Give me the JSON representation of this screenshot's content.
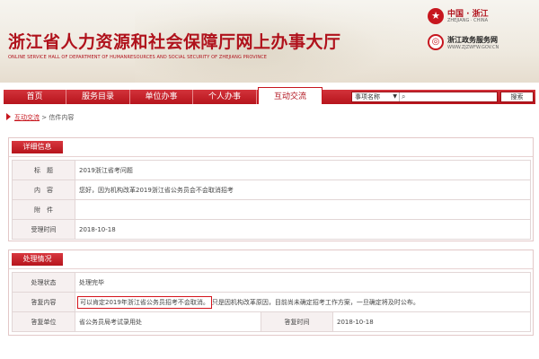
{
  "header": {
    "title": "浙江省人力资源和社会保障厅网上办事大厅",
    "subtitle": "ONLINE SERVICE HALL OF DEPARTMENT OF HUMANRESOURCES AND SOCIAL SECURITY OF ZHEJIANG PROVINCE",
    "brand_a": {
      "name": "中国 · 浙江",
      "sub": "ZHEJIANG · CHINA"
    },
    "brand_b": {
      "name": "浙江政务服务网",
      "sub": "WWW.ZJZWFW.GOV.CN"
    }
  },
  "nav": {
    "items": [
      {
        "label": "首页"
      },
      {
        "label": "服务目录"
      },
      {
        "label": "单位办事"
      },
      {
        "label": "个人办事"
      },
      {
        "label": "互动交流"
      }
    ],
    "active_index": 4,
    "search_select": "事项名称",
    "search_placeholder": "",
    "search_button": "搜索"
  },
  "breadcrumb": {
    "link": "互动交流",
    "separator": ">",
    "current": "信件内容"
  },
  "detail": {
    "heading": "详细信息",
    "rows": [
      {
        "label": "标　题",
        "value": "2019浙江省考问题"
      },
      {
        "label": "内　容",
        "value": "您好，因为机构改革2019浙江省公务员会不会取消招考"
      },
      {
        "label": "附　件",
        "value": ""
      },
      {
        "label": "受理时间",
        "value": "2018-10-18"
      }
    ]
  },
  "handling": {
    "heading": "处理情况",
    "status_label": "处理状态",
    "status_value": "处理完毕",
    "reply_label": "答复内容",
    "reply_highlight": "可以肯定2019年浙江省公务员招考不会取消。",
    "reply_rest": "只是因机构改革原因，目前尚未确定招考工作方案，一旦确定将及时公布。",
    "unit_label": "答复单位",
    "unit_value": "省公务员局考试录用处",
    "time_label": "答复时间",
    "time_value": "2018-10-18"
  },
  "colors": {
    "brand_red": "#c7161e",
    "nav_red": "#b6141c",
    "highlight_red": "#d4141c"
  }
}
